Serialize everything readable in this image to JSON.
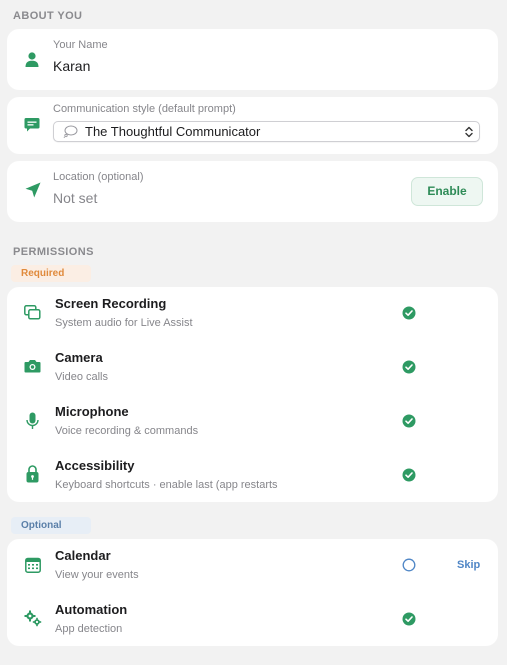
{
  "about": {
    "section_title": "ABOUT YOU",
    "name_label": "Your Name",
    "name_value": "Karan",
    "style_label": "Communication style (default prompt)",
    "style_value": "The Thoughtful Communicator",
    "location_label": "Location (optional)",
    "location_value": "Not set",
    "enable_label": "Enable"
  },
  "permissions": {
    "section_title": "PERMISSIONS",
    "required_label": "Required",
    "optional_label": "Optional",
    "required": [
      {
        "name": "Screen Recording",
        "desc": "System audio for Live Assist",
        "icon": "screen-recording-icon",
        "status": "granted"
      },
      {
        "name": "Camera",
        "desc": "Video calls",
        "icon": "camera-icon",
        "status": "granted"
      },
      {
        "name": "Microphone",
        "desc": "Voice recording & commands",
        "icon": "microphone-icon",
        "status": "granted"
      },
      {
        "name": "Accessibility",
        "desc": "Keyboard shortcuts · enable last (app restarts",
        "icon": "lock-icon",
        "status": "granted"
      }
    ],
    "optional": [
      {
        "name": "Calendar",
        "desc": "View your events",
        "icon": "calendar-icon",
        "status": "not-granted",
        "action": "Skip"
      },
      {
        "name": "Automation",
        "desc": "App detection",
        "icon": "gears-icon",
        "status": "granted"
      }
    ]
  },
  "colors": {
    "accent_green": "#2e9a63",
    "required_badge": "#e08a3c",
    "optional_badge": "#5a7fa8",
    "skip_link": "#4f86c6"
  }
}
